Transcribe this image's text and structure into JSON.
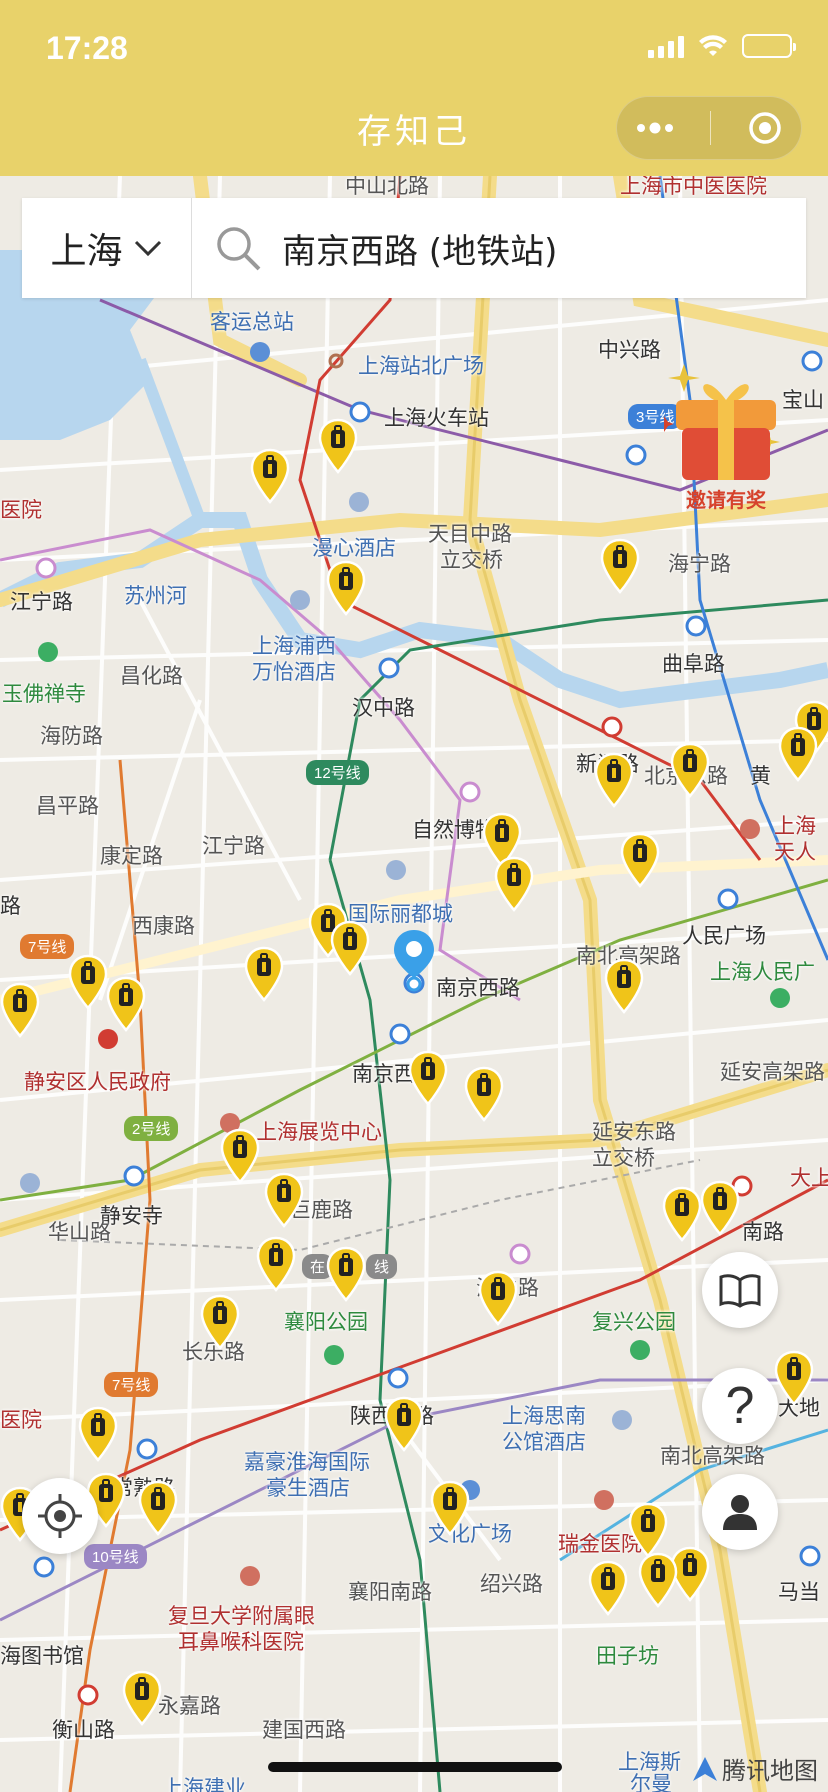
{
  "status_bar": {
    "time": "17:28"
  },
  "app": {
    "title": "存知己"
  },
  "search": {
    "city": "上海",
    "query": "南京西路 (地铁站)"
  },
  "promo": {
    "label": "邀请有奖"
  },
  "map_labels": [
    {
      "text": "中山北路",
      "cls": "road"
    },
    {
      "text": "上海市中医医院",
      "cls": "red"
    },
    {
      "text": "客运总站",
      "cls": "blue"
    },
    {
      "text": "上海站北广场",
      "cls": "blue"
    },
    {
      "text": "中兴路",
      "cls": ""
    },
    {
      "text": "宝山",
      "cls": ""
    },
    {
      "text": "上海火车站",
      "cls": ""
    },
    {
      "text": "医院",
      "cls": "red"
    },
    {
      "text": "漫心酒店",
      "cls": "blue"
    },
    {
      "text": "天目中路",
      "cls": "road"
    },
    {
      "text": "立交桥",
      "cls": "road"
    },
    {
      "text": "海宁路",
      "cls": "road"
    },
    {
      "text": "江宁路",
      "cls": ""
    },
    {
      "text": "苏州河",
      "cls": "blue"
    },
    {
      "text": "玉佛禅寺",
      "cls": "green"
    },
    {
      "text": "上海浦西",
      "cls": "blue"
    },
    {
      "text": "万怡酒店",
      "cls": "blue"
    },
    {
      "text": "汉中路",
      "cls": ""
    },
    {
      "text": "曲阜路",
      "cls": ""
    },
    {
      "text": "新闸路",
      "cls": ""
    },
    {
      "text": "昌化路",
      "cls": "road"
    },
    {
      "text": "海防路",
      "cls": "road"
    },
    {
      "text": "昌平路",
      "cls": "road"
    },
    {
      "text": "康定路",
      "cls": "road"
    },
    {
      "text": "江宁路",
      "cls": "road"
    },
    {
      "text": "自然博物馆",
      "cls": ""
    },
    {
      "text": "北京东路",
      "cls": "road"
    },
    {
      "text": "黄",
      "cls": ""
    },
    {
      "text": "上海",
      "cls": "red"
    },
    {
      "text": "天人",
      "cls": "red"
    },
    {
      "text": "路",
      "cls": ""
    },
    {
      "text": "西康路",
      "cls": "road"
    },
    {
      "text": "国际丽都城",
      "cls": "blue"
    },
    {
      "text": "人民广场",
      "cls": ""
    },
    {
      "text": "上海人民广",
      "cls": "green"
    },
    {
      "text": "南京西路",
      "cls": ""
    },
    {
      "text": "南北高架路",
      "cls": "road"
    },
    {
      "text": "静安区人民政府",
      "cls": "red"
    },
    {
      "text": "南京西",
      "cls": ""
    },
    {
      "text": "延安高架路",
      "cls": "road"
    },
    {
      "text": "上海展览中心",
      "cls": "red"
    },
    {
      "text": "延安东路",
      "cls": "road"
    },
    {
      "text": "立交桥",
      "cls": "road"
    },
    {
      "text": "大上",
      "cls": "red"
    },
    {
      "text": "静安寺",
      "cls": ""
    },
    {
      "text": "巨鹿路",
      "cls": "road"
    },
    {
      "text": "南路",
      "cls": ""
    },
    {
      "text": "华山路",
      "cls": "road"
    },
    {
      "text": "海中路",
      "cls": "road"
    },
    {
      "text": "复兴公园",
      "cls": "green"
    },
    {
      "text": "襄阳公园",
      "cls": "green"
    },
    {
      "text": "长乐路",
      "cls": "road"
    },
    {
      "text": "医院",
      "cls": "red"
    },
    {
      "text": "陕西南路",
      "cls": ""
    },
    {
      "text": "上海思南",
      "cls": "blue"
    },
    {
      "text": "公馆酒店",
      "cls": "blue"
    },
    {
      "text": "南北高架路",
      "cls": "road"
    },
    {
      "text": "大地",
      "cls": ""
    },
    {
      "text": "嘉豪淮海国际",
      "cls": "blue"
    },
    {
      "text": "豪生酒店",
      "cls": "blue"
    },
    {
      "text": "常熟路",
      "cls": ""
    },
    {
      "text": "文化广场",
      "cls": "blue"
    },
    {
      "text": "瑞金医院",
      "cls": "red"
    },
    {
      "text": "马当",
      "cls": ""
    },
    {
      "text": "襄阳南路",
      "cls": "road"
    },
    {
      "text": "绍兴路",
      "cls": "road"
    },
    {
      "text": "复旦大学附属眼",
      "cls": "red"
    },
    {
      "text": "耳鼻喉科医院",
      "cls": "red"
    },
    {
      "text": "海图书馆",
      "cls": ""
    },
    {
      "text": "田子坊",
      "cls": "green"
    },
    {
      "text": "永嘉路",
      "cls": "road"
    },
    {
      "text": "衡山路",
      "cls": ""
    },
    {
      "text": "建国西路",
      "cls": "road"
    },
    {
      "text": "上海建业",
      "cls": "blue"
    },
    {
      "text": "上海斯",
      "cls": "blue"
    },
    {
      "text": "尔曼",
      "cls": "blue"
    }
  ],
  "line_badges": [
    {
      "text": "12号线",
      "color": "#2e8a5e"
    },
    {
      "text": "7号线",
      "color": "#e07a30"
    },
    {
      "text": "2号线",
      "color": "#7fb040"
    },
    {
      "text": "7号线",
      "color": "#e07a30"
    },
    {
      "text": "10号线",
      "color": "#9b87c4"
    },
    {
      "text": "3号线",
      "color": "#3c80d8"
    },
    {
      "text": "在",
      "color": "#8a8a8a"
    },
    {
      "text": "线",
      "color": "#8a8a8a"
    }
  ],
  "watermark": "腾讯地图",
  "colors": {
    "header": "#e8d26a",
    "pin": "#f0c419",
    "line_red": "#d13c32",
    "line_green": "#2e8a5e",
    "line_purple": "#8c5ba8",
    "line_blue": "#3c80d8",
    "line_orange": "#e07a30",
    "line_lime": "#7fb040",
    "water": "#b7d6ee"
  }
}
